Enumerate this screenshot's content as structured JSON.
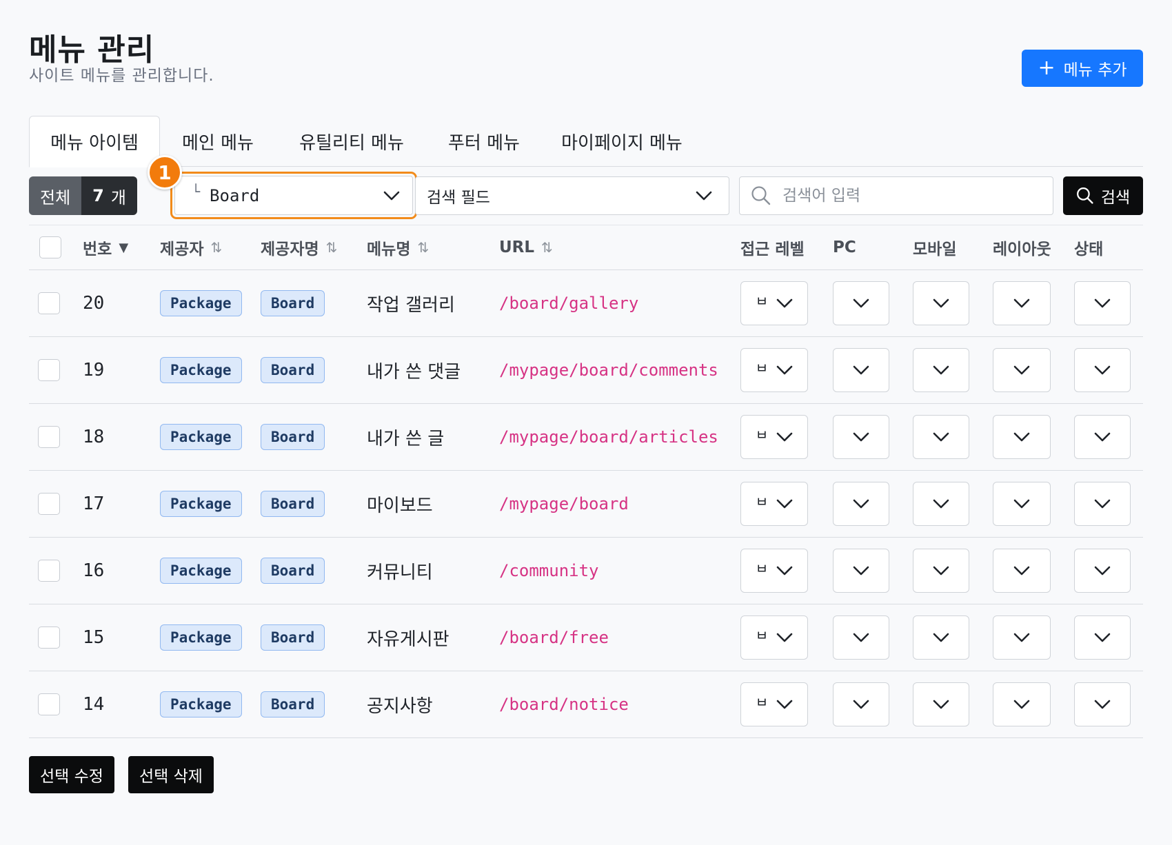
{
  "header": {
    "title": "메뉴 관리",
    "subtitle": "사이트 메뉴를 관리합니다.",
    "add_button": "메뉴 추가"
  },
  "tabs": [
    {
      "label": "메뉴 아이템",
      "active": true
    },
    {
      "label": "메인 메뉴",
      "active": false
    },
    {
      "label": "유틸리티 메뉴",
      "active": false
    },
    {
      "label": "푸터 메뉴",
      "active": false
    },
    {
      "label": "마이페이지 메뉴",
      "active": false
    }
  ],
  "toolbar": {
    "total_label": "전체",
    "total_count": "7",
    "total_unit": "개",
    "category_marker": "1",
    "category_value": "Board",
    "field_placeholder": "검색 필드",
    "search_placeholder": "검색어 입력",
    "search_button": "검색"
  },
  "table": {
    "columns": [
      "번호",
      "제공자",
      "제공자명",
      "메뉴명",
      "URL",
      "접근 레벨",
      "PC",
      "모바일",
      "레이아웃",
      "상태"
    ],
    "rows": [
      {
        "no": "20",
        "provider": "Package",
        "provider_name": "Board",
        "menu_name": "작업 갤러리",
        "url": "/board/gallery",
        "level": "ㅂ"
      },
      {
        "no": "19",
        "provider": "Package",
        "provider_name": "Board",
        "menu_name": "내가 쓴 댓글",
        "url": "/mypage/board/comments",
        "level": "ㅂ"
      },
      {
        "no": "18",
        "provider": "Package",
        "provider_name": "Board",
        "menu_name": "내가 쓴 글",
        "url": "/mypage/board/articles",
        "level": "ㅂ"
      },
      {
        "no": "17",
        "provider": "Package",
        "provider_name": "Board",
        "menu_name": "마이보드",
        "url": "/mypage/board",
        "level": "ㅂ"
      },
      {
        "no": "16",
        "provider": "Package",
        "provider_name": "Board",
        "menu_name": "커뮤니티",
        "url": "/community",
        "level": "ㅂ"
      },
      {
        "no": "15",
        "provider": "Package",
        "provider_name": "Board",
        "menu_name": "자유게시판",
        "url": "/board/free",
        "level": "ㅂ"
      },
      {
        "no": "14",
        "provider": "Package",
        "provider_name": "Board",
        "menu_name": "공지사항",
        "url": "/board/notice",
        "level": "ㅂ"
      }
    ]
  },
  "footer": {
    "edit_selected": "선택 수정",
    "delete_selected": "선택 삭제"
  },
  "colors": {
    "primary": "#1677ff",
    "highlight": "#f28b1a",
    "url": "#d63384",
    "tag_bg": "#dce9fb"
  },
  "icons": {
    "add": "plus-icon",
    "search": "search-icon",
    "dropdown": "chevron-down-icon",
    "sort": "sort-arrows-icon",
    "sort_active": "caret-down-icon"
  }
}
